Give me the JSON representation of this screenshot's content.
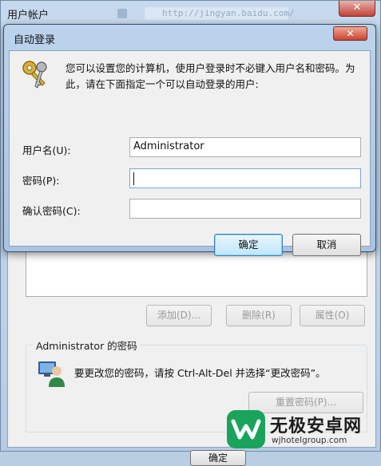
{
  "background_window": {
    "title": "用户帐户",
    "blurred_address": "http://jingyan.baidu.com/",
    "close_label": "✕",
    "buttons": {
      "add": "添加(D)...",
      "delete": "删除(R)",
      "properties": "属性(O)"
    },
    "password_group": {
      "title": "Administrator 的密码",
      "hint": "要更改您的密码，请按 Ctrl-Alt-Del 并选择“更改密码”。",
      "reset_button": "重置密码(P)..."
    },
    "ok_button": "确定"
  },
  "dialog": {
    "title": "自动登录",
    "close_label": "✕",
    "description": "您可以设置您的计算机，使用户登录时不必键入用户名和密码。为此，请在下面指定一个可以自动登录的用户:",
    "fields": {
      "user_label": "用户名(U):",
      "user_value": "Administrator",
      "password_label": "密码(P):",
      "password_value": "",
      "confirm_label": "确认密码(C):",
      "confirm_value": ""
    },
    "ok_button": "确定",
    "cancel_button": "取消"
  },
  "watermark": {
    "title": "无极安卓网",
    "url": "wjhotelgroup.com"
  },
  "colors": {
    "title_bar": "#b9cde3",
    "close_red": "#c9442f",
    "default_button_blue": "#bee6fd",
    "watermark_green": "#1aa45b"
  },
  "icons": [
    "keys-icon",
    "user-icon",
    "close-icon"
  ]
}
